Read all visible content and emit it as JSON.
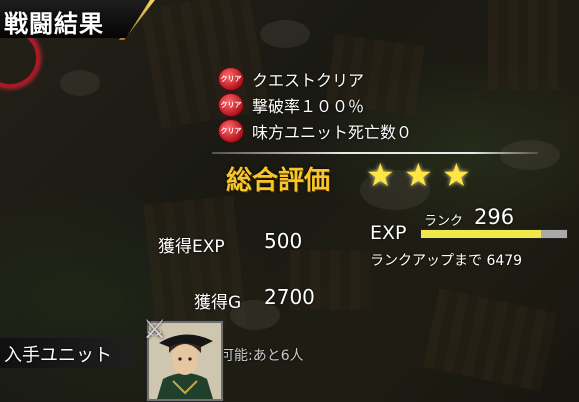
{
  "header": {
    "title": "戦闘結果"
  },
  "conditions": {
    "badge_label": "クリア",
    "items": [
      {
        "text": "クエストクリア"
      },
      {
        "text": "撃破率１００％"
      },
      {
        "text": "味方ユニット死亡数０"
      }
    ]
  },
  "rating": {
    "label": "総合評価",
    "stars": 3
  },
  "rewards": {
    "exp_label": "獲得EXP",
    "exp_value": "500",
    "gold_label": "獲得G",
    "gold_value": "2700"
  },
  "rank": {
    "exp_title": "EXP",
    "rank_label": "ランク",
    "rank_value": "296",
    "exp_progress_fraction": 0.82,
    "rankup_text": "ランクアップまで 6479"
  },
  "unit": {
    "title": "入手ユニット",
    "remaining_text": "可能:あと6人"
  },
  "colors": {
    "rating_gold": "#f8c62a",
    "star_yellow": "#ffe544",
    "exp_fill": "#f1e84a",
    "badge_red": "#b3121d"
  },
  "icons": {
    "star": "star-icon",
    "badge": "clear-badge-icon",
    "swords": "crossed-swords-icon"
  }
}
